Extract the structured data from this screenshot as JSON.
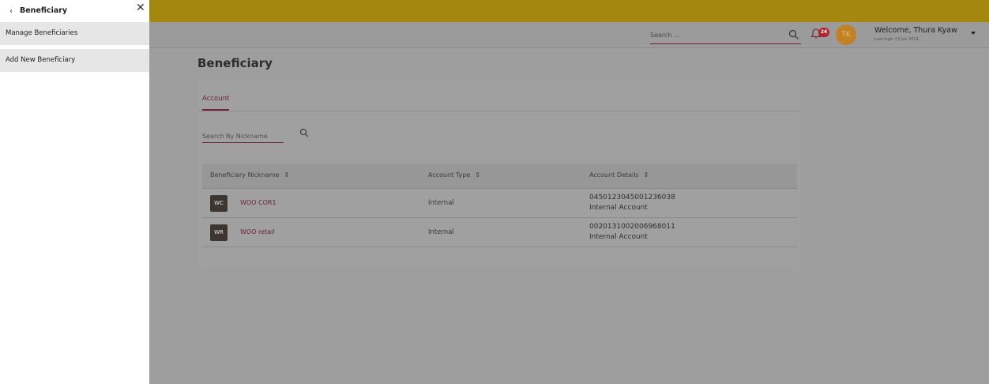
{
  "drawer": {
    "back_glyph": "‹",
    "title": "Beneficiary",
    "close_glyph": "✕",
    "items": [
      {
        "label": "Manage Beneficiaries"
      },
      {
        "label": "Add New Beneficiary"
      }
    ]
  },
  "header": {
    "search_placeholder": "Search ...",
    "notification_count": "24",
    "avatar_initials": "TK",
    "welcome": "Welcome, Thura Kyaw",
    "last_login": "Last login 23 Jan 2024,"
  },
  "page": {
    "title": "Beneficiary",
    "tab": "Account",
    "nickname_search_placeholder": "Search By Nickname"
  },
  "table": {
    "columns": [
      {
        "label": "Beneficiary Nickname"
      },
      {
        "label": "Account Type"
      },
      {
        "label": "Account Details"
      }
    ],
    "sort_glyph": "⇕",
    "rows": [
      {
        "initials": "WC",
        "nickname": "WOO COR1",
        "type": "Internal",
        "account_number": "0450123045001236038",
        "account_desc": "Internal Account"
      },
      {
        "initials": "WR",
        "nickname": "WOO retail",
        "type": "Internal",
        "account_number": "0020131002006968011",
        "account_desc": "Internal Account"
      }
    ]
  },
  "colors": {
    "topbar": "#a3870f",
    "accent": "#6b2430",
    "badge": "#b5232c"
  }
}
